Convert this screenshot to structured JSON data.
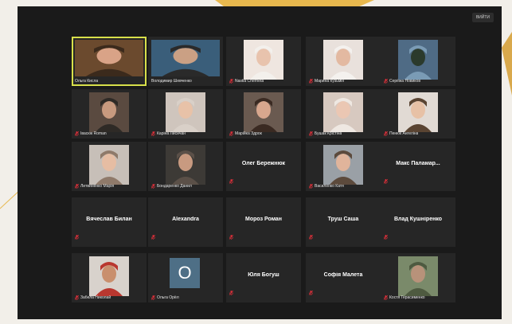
{
  "toolbar": {
    "exit_label": "ВИЙТИ"
  },
  "colors": {
    "active_speaker": "#d8e04a",
    "muted_icon": "#e0303a",
    "tile_bg": "#262626",
    "frame_bg": "#1a1a1a"
  },
  "participants": [
    {
      "name": "Ольга Кисла",
      "display": "",
      "muted": false,
      "video": true,
      "active": true
    },
    {
      "name": "Володимир Шевченко",
      "display": "",
      "muted": false,
      "video": true,
      "active": false
    },
    {
      "name": "Nastia Cherneta",
      "display": "",
      "muted": true,
      "video": true,
      "active": false
    },
    {
      "name": "Марина Кузьмін",
      "display": "",
      "muted": true,
      "video": true,
      "active": false
    },
    {
      "name": "Серёжа Новиков",
      "display": "",
      "muted": true,
      "video": true,
      "active": false
    },
    {
      "name": "Івасюк Roman",
      "display": "",
      "muted": true,
      "video": true,
      "active": false
    },
    {
      "name": "Каріна Лисичан",
      "display": "",
      "muted": true,
      "video": true,
      "active": false
    },
    {
      "name": "Марійка Здрок",
      "display": "",
      "muted": true,
      "video": true,
      "active": false
    },
    {
      "name": "Бушак Крістіна",
      "display": "",
      "muted": true,
      "video": true,
      "active": false
    },
    {
      "name": "Пенюк Ангеліна",
      "display": "",
      "muted": true,
      "video": true,
      "active": false
    },
    {
      "name": "Литвиненко Марія",
      "display": "",
      "muted": true,
      "video": true,
      "active": false
    },
    {
      "name": "Бондаренко Данил",
      "display": "",
      "muted": true,
      "video": true,
      "active": false
    },
    {
      "name": "",
      "display": "Олег Бережнюк",
      "muted": true,
      "video": false,
      "active": false
    },
    {
      "name": "Василенко Катя",
      "display": "",
      "muted": true,
      "video": true,
      "active": false
    },
    {
      "name": "",
      "display": "Макс  Паламар...",
      "muted": true,
      "video": false,
      "active": false
    },
    {
      "name": "",
      "display": "Вячеслав Билан",
      "muted": true,
      "video": false,
      "active": false
    },
    {
      "name": "",
      "display": "Alexandra",
      "muted": true,
      "video": false,
      "active": false
    },
    {
      "name": "",
      "display": "Мороз Роман",
      "muted": true,
      "video": false,
      "active": false
    },
    {
      "name": "",
      "display": "Труш Саша",
      "muted": true,
      "video": false,
      "active": false
    },
    {
      "name": "",
      "display": "Влад Кушніренко",
      "muted": true,
      "video": false,
      "active": false
    },
    {
      "name": "Забела Николай",
      "display": "",
      "muted": true,
      "video": true,
      "active": false
    },
    {
      "name": "Ольга Орёл",
      "display": "",
      "muted": true,
      "video": false,
      "active": false,
      "initial": "O"
    },
    {
      "name": "",
      "display": "Юля Богуш",
      "muted": true,
      "video": false,
      "active": false
    },
    {
      "name": "",
      "display": "Софія Малета",
      "muted": true,
      "video": false,
      "active": false
    },
    {
      "name": "Костя Герасименко",
      "display": "",
      "muted": true,
      "video": true,
      "active": false
    }
  ]
}
